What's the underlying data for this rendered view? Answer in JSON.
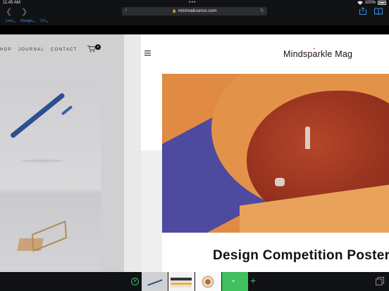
{
  "status": {
    "time": "11:45 AM",
    "dots": "•••",
    "battery": "100%"
  },
  "browser": {
    "url": "minimalissimo.com",
    "favorites": [
      {
        "label": "Live"
      },
      {
        "label": "Design"
      },
      {
        "label": "UX"
      }
    ]
  },
  "left_pane": {
    "nav": [
      "HOP",
      "JOURNAL",
      "CONTACT"
    ],
    "cart_count": "0"
  },
  "right_pane": {
    "title": "Mindsparkle Mag",
    "headline": "Design Competition Poster"
  },
  "colors": {
    "accent": "#37c26a",
    "link": "#3b8ff0",
    "hero_orange": "#e08a44",
    "hero_purple": "#4e4aa0"
  },
  "icons": {
    "back": "chevron-left-icon",
    "forward": "chevron-right-icon",
    "share": "share-icon",
    "bookmarks": "book-icon",
    "cart": "cart-icon",
    "menu": "hamburger-icon",
    "close_tabs": "close-circle-icon",
    "new_tab": "plus-icon",
    "tabs": "tabs-icon"
  }
}
